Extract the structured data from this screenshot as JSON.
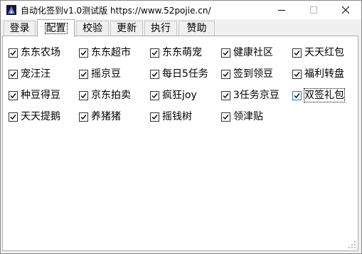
{
  "window": {
    "title": "自动化签到v1.0测试版  https://www.52pojie.cn/",
    "icon": "app-icon",
    "controls": [
      "minimize-icon",
      "maximize-icon",
      "close-icon"
    ]
  },
  "tabs": [
    {
      "label": "登录",
      "active": false
    },
    {
      "label": "配置",
      "active": true
    },
    {
      "label": "校验",
      "active": false
    },
    {
      "label": "更新",
      "active": false
    },
    {
      "label": "执行",
      "active": false
    },
    {
      "label": "赞助",
      "active": false
    }
  ],
  "config": {
    "items": [
      {
        "label": "东东农场",
        "checked": true
      },
      {
        "label": "东东超市",
        "checked": true
      },
      {
        "label": "东东萌宠",
        "checked": true
      },
      {
        "label": "健康社区",
        "checked": true
      },
      {
        "label": "天天红包",
        "checked": true
      },
      {
        "label": "宠汪汪",
        "checked": true
      },
      {
        "label": "摇京豆",
        "checked": true
      },
      {
        "label": "每日5任务",
        "checked": true
      },
      {
        "label": "签到领豆",
        "checked": true
      },
      {
        "label": "福利转盘",
        "checked": true
      },
      {
        "label": "种豆得豆",
        "checked": true
      },
      {
        "label": "京东拍卖",
        "checked": true
      },
      {
        "label": "疯狂joy",
        "checked": true
      },
      {
        "label": "3任务京豆",
        "checked": true
      },
      {
        "label": "双签礼包",
        "checked": true,
        "focused": true
      },
      {
        "label": "天天提鹅",
        "checked": true
      },
      {
        "label": "养猪猪",
        "checked": true
      },
      {
        "label": "摇钱树",
        "checked": true
      },
      {
        "label": "领津贴",
        "checked": true
      }
    ]
  },
  "colors": {
    "window_bg": "#f0f0f0",
    "panel_bg": "#ffffff",
    "checkmark": "#000000",
    "focus_accent": "#1f7bd4"
  }
}
